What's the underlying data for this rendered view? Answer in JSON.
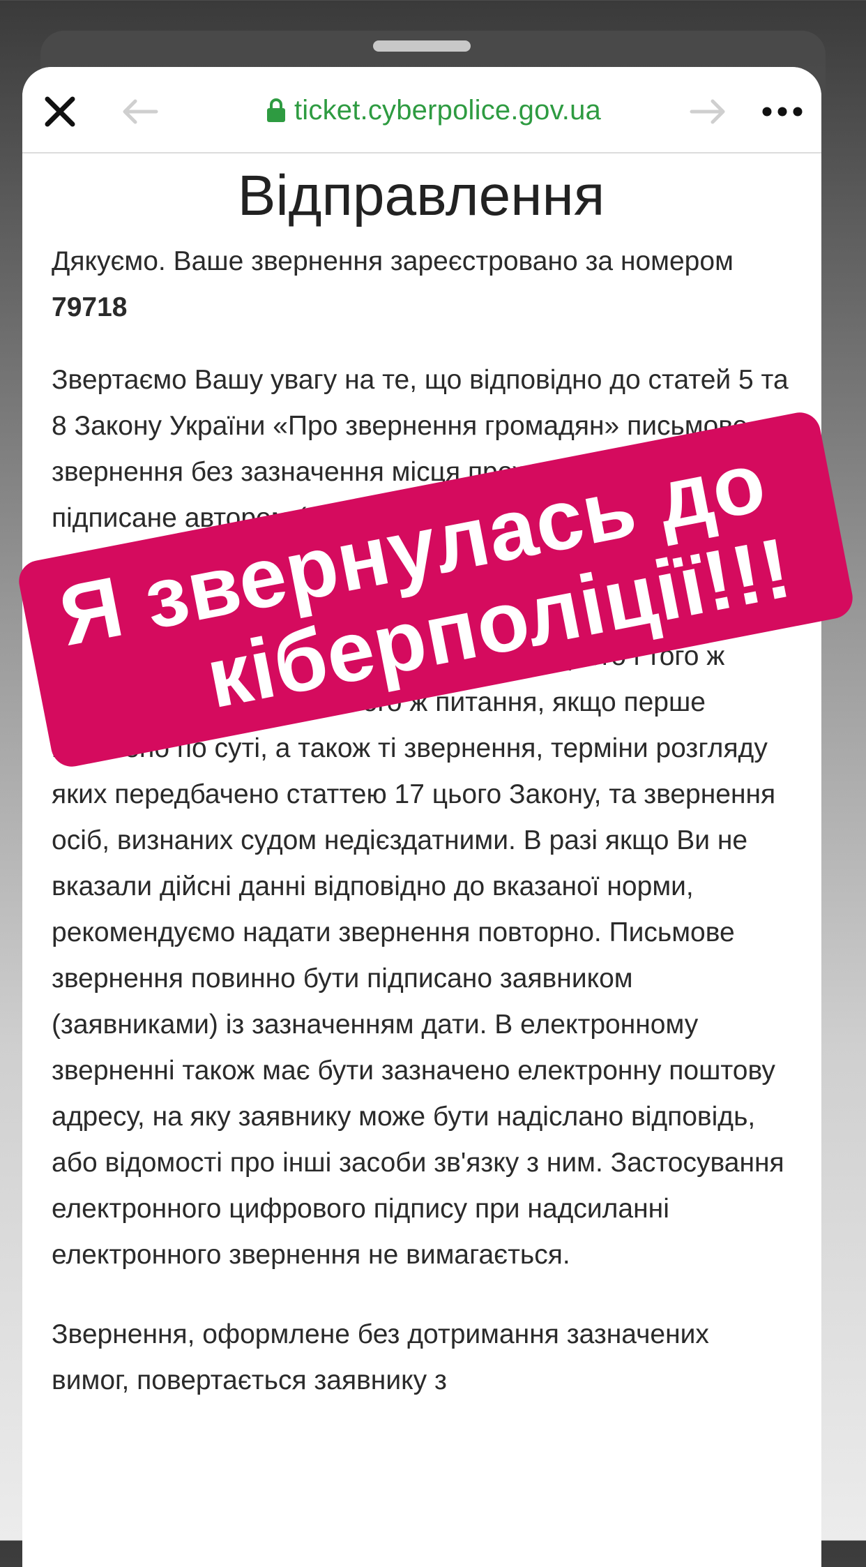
{
  "browser": {
    "url": "ticket.cyberpolice.gov.ua",
    "colors": {
      "url_green": "#2e9b41",
      "nav_icon_gray": "#cfcfcf",
      "close_black": "#111111"
    },
    "icons": {
      "close": "close-icon",
      "back": "back-arrow-icon",
      "forward": "forward-arrow-icon",
      "lock": "lock-icon",
      "more": "more-icon"
    }
  },
  "page": {
    "title": "Відправлення",
    "thanks_text": "Дякуємо. Ваше звернення зареєстровано за номером",
    "ticket_number": "79718",
    "main_paragraph": "Звертаємо Вашу увагу на те, що відповідно до статей 5 та 8 Закону України «Про звернення громадян» письмове звернення без зазначення місця проживання, не підписане автором (авторами), а також таке, з якого неможливо встановити авторство, визнається анонімним і розгляду не підлягає. Не розглядаються повторні звернення одним і тим же органом від одного і того ж громадянина з одного і того ж питання, якщо перше вирішено по суті, а також ті звернення, терміни розгляду яких передбачено статтею 17 цього Закону, та звернення осіб, визнаних судом недієздатними. В разі якщо Ви не вказали дійсні данні відповідно до вказаної норми, рекомендуємо надати звернення повторно. Письмове звернення повинно бути підписано заявником (заявниками) із зазначенням дати. В електронному зверненні також має бути зазначено електронну поштову адресу, на яку заявнику може бути надіслано відповідь, або відомості про інші засоби зв'язку з ним. Застосування електронного цифрового підпису при надсиланні електронного звернення не вимагається.",
    "tail_paragraph": "Звернення, оформлене без дотримання зазначених вимог, повертається заявнику з"
  },
  "sticker": {
    "line1": "Я звернулась до",
    "line2": "кіберполіції!!!",
    "color": "#d50b5e"
  }
}
